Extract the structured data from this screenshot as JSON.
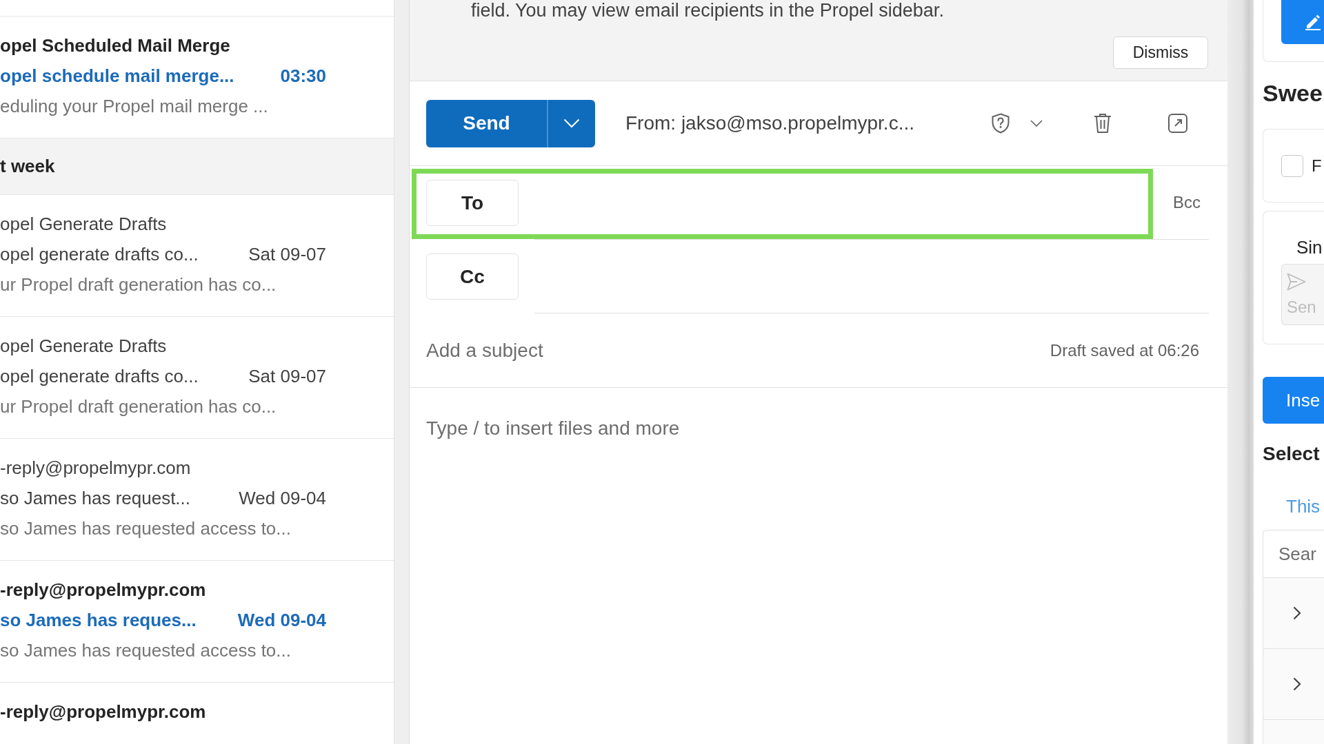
{
  "mail_list": {
    "items": [
      {
        "kind": "message",
        "sender": "opel Scheduled Mail Merge",
        "subject": "opel schedule mail merge...",
        "time": "03:30",
        "preview": "eduling your Propel mail merge ...",
        "unread": true
      },
      {
        "kind": "group_header",
        "label": "t week"
      },
      {
        "kind": "message",
        "sender": "opel Generate Drafts",
        "subject": "opel generate drafts co...",
        "time": "Sat 09-07",
        "preview": "ur Propel draft generation has co...",
        "unread": false
      },
      {
        "kind": "message",
        "sender": "opel Generate Drafts",
        "subject": "opel generate drafts co...",
        "time": "Sat 09-07",
        "preview": "ur Propel draft generation has co...",
        "unread": false
      },
      {
        "kind": "message",
        "sender": "-reply@propelmypr.com",
        "subject": "so James has request...",
        "time": "Wed 09-04",
        "preview": "so James has requested access to...",
        "unread": false
      },
      {
        "kind": "message",
        "sender": "-reply@propelmypr.com",
        "subject": "so James has reques...",
        "time": "Wed 09-04",
        "preview": "so James has requested access to...",
        "unread": true
      },
      {
        "kind": "message",
        "sender": "-reply@propelmypr.com",
        "unread": true
      }
    ]
  },
  "compose": {
    "notice": {
      "text": "field. You may view email recipients in the Propel sidebar.",
      "dismiss": "Dismiss"
    },
    "send": "Send",
    "from": "From: jakso@mso.propelmypr.c...",
    "recipients": [
      {
        "label": "To",
        "highlighted": true,
        "action": "Bcc"
      },
      {
        "label": "Cc",
        "highlighted": false
      }
    ],
    "subject": {
      "placeholder": "Add a subject"
    },
    "draft_status": "Draft saved at 06:26",
    "body": {
      "placeholder": "Type / to insert files and more"
    }
  },
  "sidebar": {
    "heading": "Swee",
    "option": {
      "label": "F",
      "checked": false
    },
    "card": {
      "title": "Sin",
      "button": "Sen",
      "disabled": true
    },
    "insert_button": "Inse",
    "section_label": "Select",
    "link": "This",
    "search": {
      "placeholder": "Sear"
    },
    "rows": [
      {
        "kind": "expandable",
        "expanded": false
      },
      {
        "kind": "expandable",
        "expanded": false
      },
      {
        "kind": "blank"
      }
    ]
  }
}
